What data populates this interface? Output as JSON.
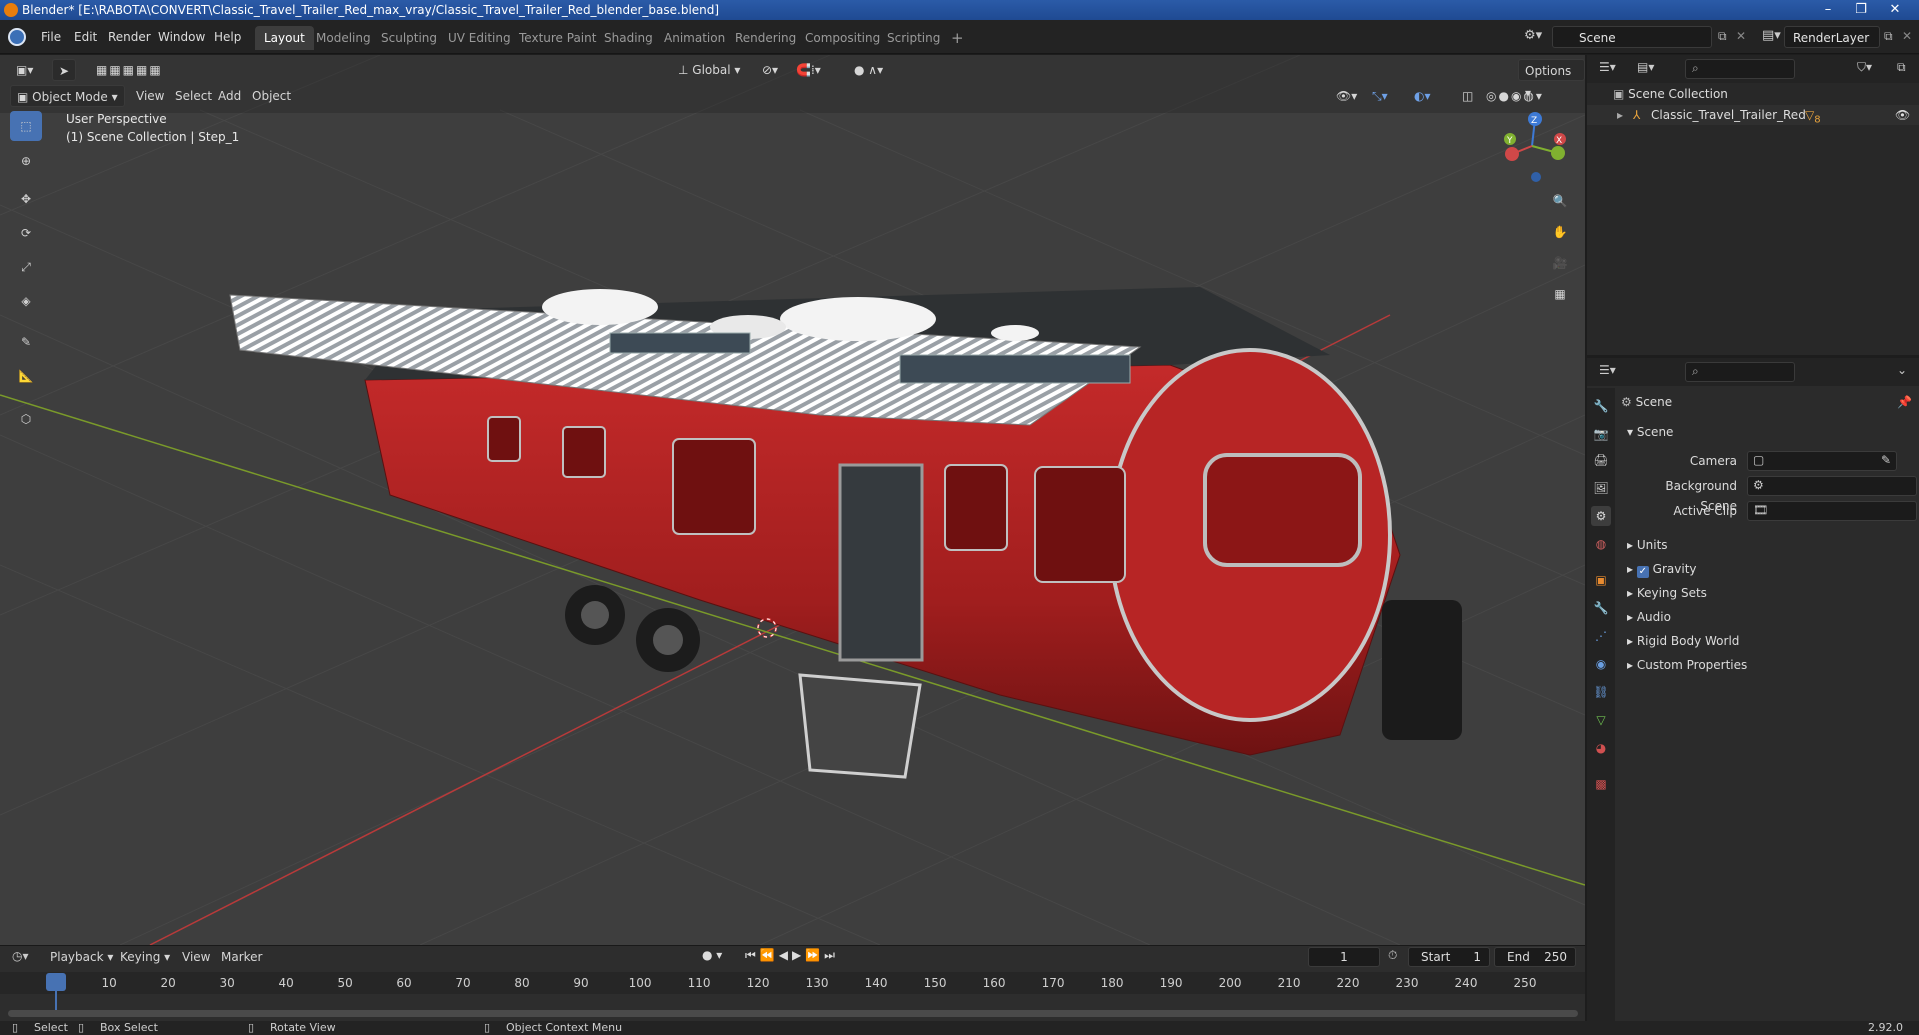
{
  "window": {
    "title": "Blender* [E:\\RABOTA\\CONVERT\\Classic_Travel_Trailer_Red_max_vray/Classic_Travel_Trailer_Red_blender_base.blend]"
  },
  "menu": {
    "items": [
      "File",
      "Edit",
      "Render",
      "Window",
      "Help"
    ]
  },
  "workspaces": {
    "tabs": [
      "Layout",
      "Modeling",
      "Sculpting",
      "UV Editing",
      "Texture Paint",
      "Shading",
      "Animation",
      "Rendering",
      "Compositing",
      "Scripting"
    ],
    "active": "Layout",
    "add_label": "+"
  },
  "scene_selector": {
    "value": "Scene"
  },
  "layer_selector": {
    "value": "RenderLayer"
  },
  "viewport_header": {
    "mode": "Object Mode",
    "menus": [
      "View",
      "Select",
      "Add",
      "Object"
    ],
    "orientation": "Global",
    "options_label": "Options"
  },
  "viewport": {
    "perspective": "User Perspective",
    "collection_info": "(1) Scene Collection | Step_1",
    "gizmo_axes": [
      "X",
      "Y",
      "Z"
    ]
  },
  "outliner": {
    "root": "Scene Collection",
    "items": [
      {
        "label": "Classic_Travel_Trailer_Red",
        "badge": "8"
      }
    ]
  },
  "properties": {
    "context": "Scene",
    "panel_title": "Scene",
    "fields": [
      {
        "label": "Camera",
        "value": ""
      },
      {
        "label": "Background Scene",
        "value": ""
      },
      {
        "label": "Active Clip",
        "value": ""
      }
    ],
    "sections": [
      {
        "label": "Units",
        "checkbox": false
      },
      {
        "label": "Gravity",
        "checkbox": true
      },
      {
        "label": "Keying Sets",
        "checkbox": false
      },
      {
        "label": "Audio",
        "checkbox": false
      },
      {
        "label": "Rigid Body World",
        "checkbox": false
      },
      {
        "label": "Custom Properties",
        "checkbox": false
      }
    ]
  },
  "timeline": {
    "menus": [
      "Playback",
      "Keying",
      "View",
      "Marker"
    ],
    "current_frame": "1",
    "start_label": "Start",
    "start": "1",
    "end_label": "End",
    "end": "250",
    "ticks": [
      "1",
      "10",
      "20",
      "30",
      "40",
      "50",
      "60",
      "70",
      "80",
      "90",
      "100",
      "110",
      "120",
      "130",
      "140",
      "150",
      "160",
      "170",
      "180",
      "190",
      "200",
      "210",
      "220",
      "230",
      "240",
      "250"
    ]
  },
  "statusbar": {
    "select": "Select",
    "box_select": "Box Select",
    "rotate_view": "Rotate View",
    "context_menu": "Object Context Menu",
    "version": "2.92.0"
  },
  "colors": {
    "accent": "#4772b3",
    "trailer_red": "#a11e1e",
    "grid_red_axis": "#b83a3a",
    "grid_green_axis": "#7a9a2a",
    "titlebar": "#2457a6"
  }
}
